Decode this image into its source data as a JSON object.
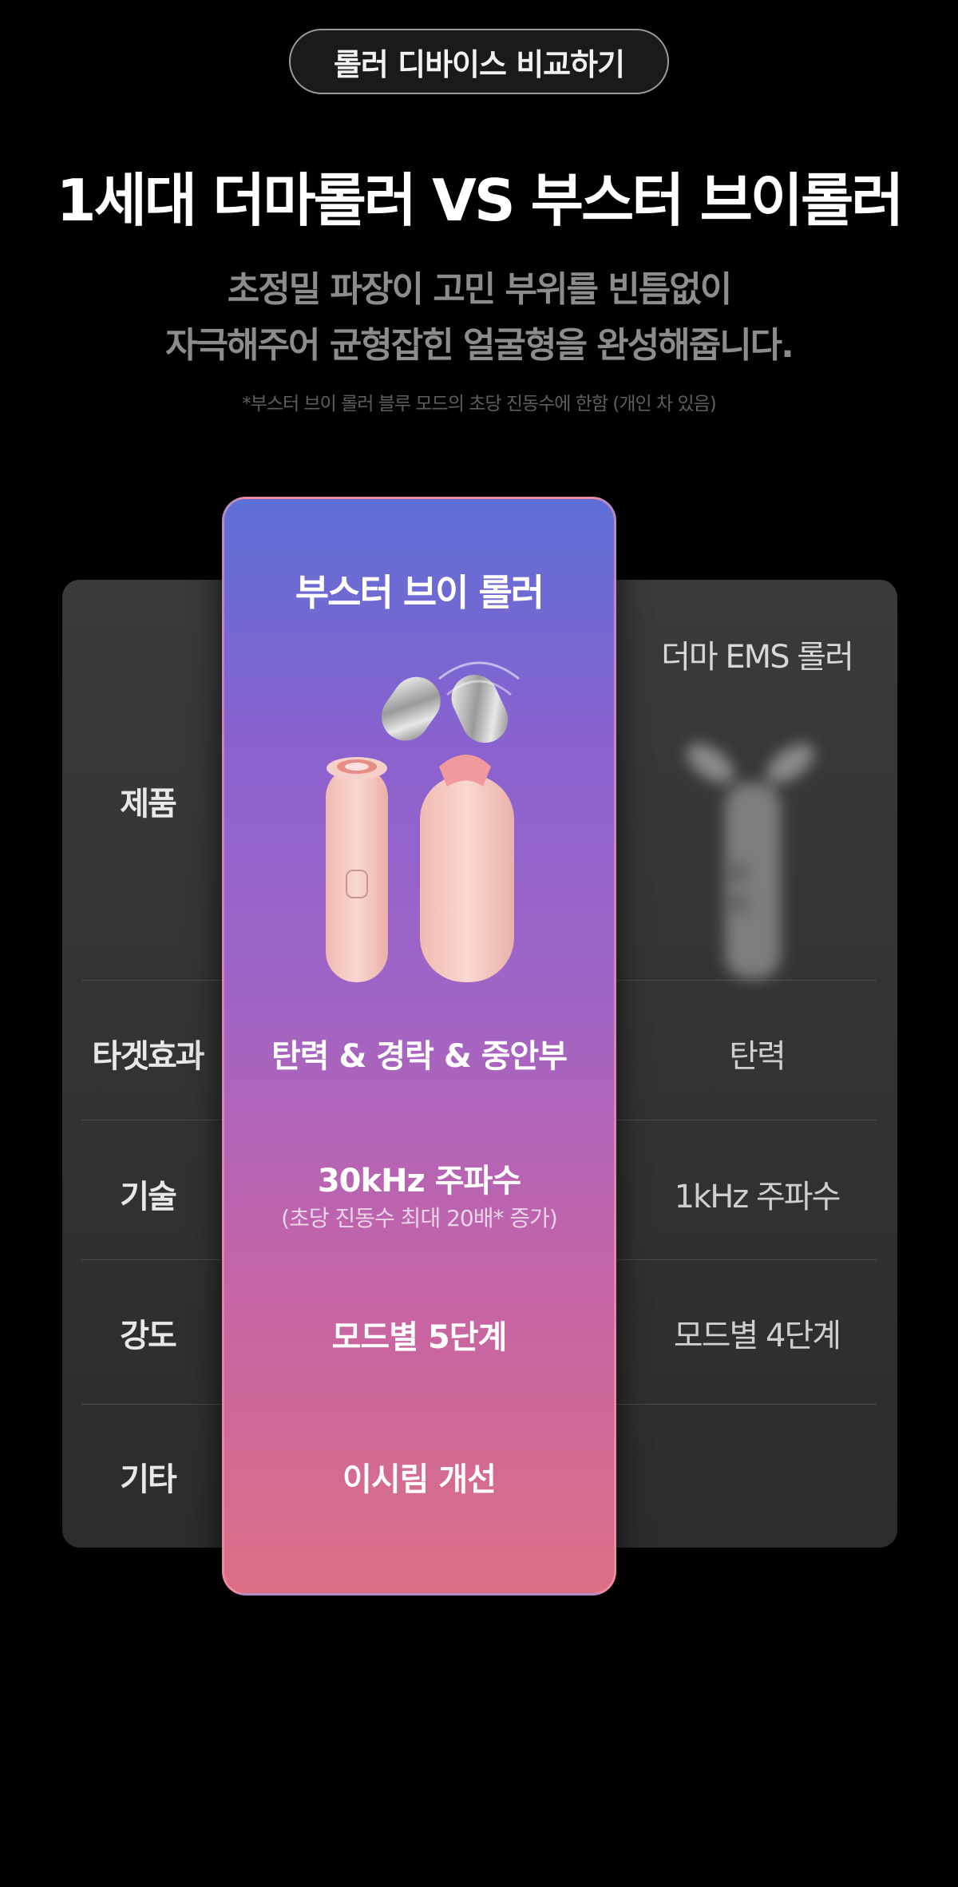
{
  "header": {
    "pill_label": "롤러 디바이스 비교하기",
    "title": "1세대 더마롤러 VS 부스터 브이롤러",
    "subtitle_line1": "초정밀 파장이 고민 부위를 빈틈없이",
    "subtitle_line2": "자극해주어 균형잡힌 얼굴형을 완성해줍니다.",
    "footnote": "*부스터 브이 롤러 블루 모드의 초당 진동수에 한함 (개인 차 있음)"
  },
  "comparison": {
    "rows": [
      {
        "label": "제품"
      },
      {
        "label": "타겟효과"
      },
      {
        "label": "기술"
      },
      {
        "label": "강도"
      },
      {
        "label": "기타"
      }
    ],
    "featured": {
      "name": "부스터 브이 롤러",
      "target": "탄력 & 경락 & 중안부",
      "tech": "30kHz  주파수",
      "tech_note": "(초당 진동수 최대 20배* 증가)",
      "intensity": "모드별 5단계",
      "other": "이시림 개선"
    },
    "other": {
      "name": "더마 EMS 롤러",
      "target": "탄력",
      "tech": "1kHz 주파수",
      "intensity": "모드별 4단계",
      "other": ""
    }
  },
  "colors": {
    "background": "#000000",
    "table_bg": "#333333",
    "highlight_top": "#5d6fd6",
    "highlight_bottom": "#dc6f86",
    "device_pink": "#f4c8c2"
  }
}
